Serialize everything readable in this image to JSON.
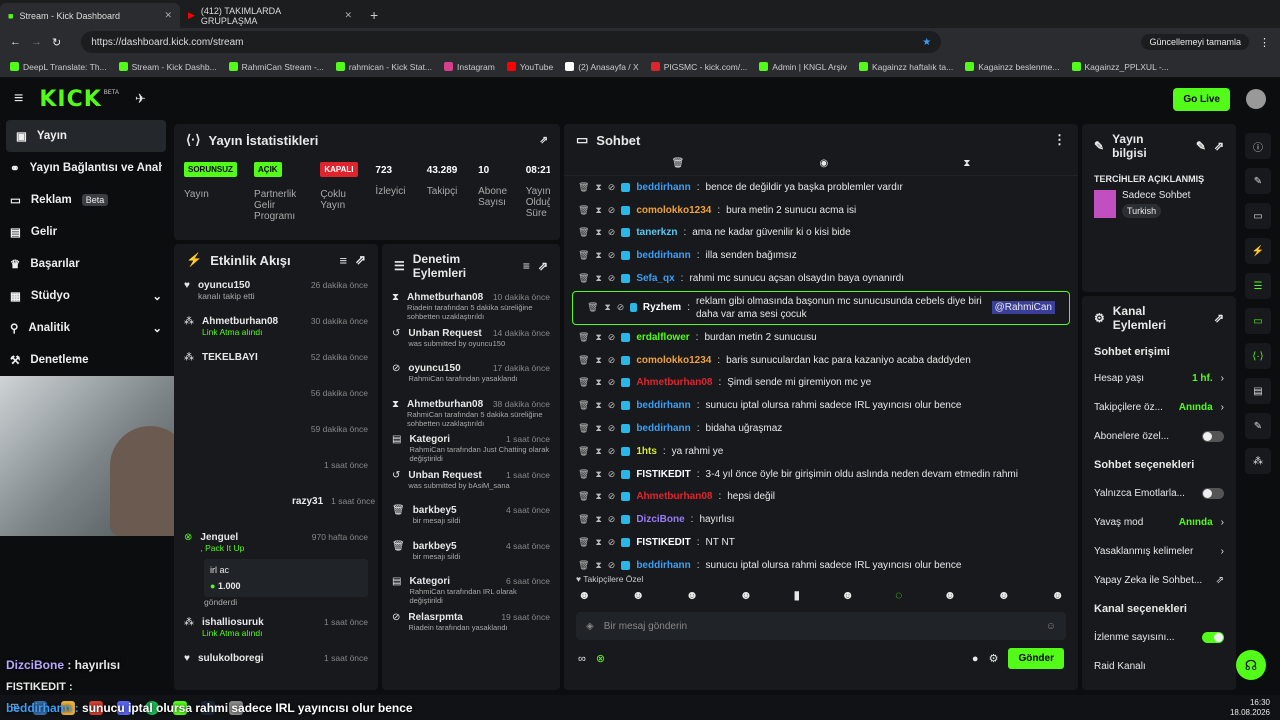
{
  "browser": {
    "tabs": [
      {
        "label": "Stream - Kick Dashboard",
        "active": true
      },
      {
        "label": "(412) TAKIMLARDA GRUPLAŞMA",
        "active": false
      }
    ],
    "url": "https://dashboard.kick.com/stream",
    "update_label": "Güncellemeyi tamamla",
    "bookmarks": [
      "DeepL Translate: Th...",
      "Stream - Kick Dashb...",
      "RahmiCan Stream -...",
      "rahmican - Kick Stat...",
      "Instagram",
      "YouTube",
      "(2) Anasayfa / X",
      "PIGSMC - kick.com/...",
      "Admin | KNGL Arşiv",
      "Kagainzz haftalık ta...",
      "Kagainzz beslenme...",
      "Kagainzz_PPLXUL -..."
    ]
  },
  "header": {
    "logo": "KICK",
    "beta": "BETA",
    "go_live": "Go Live"
  },
  "sidebar": {
    "items": [
      {
        "label": "Yayın",
        "active": true
      },
      {
        "label": "Yayın Bağlantısı ve Anahtarı"
      },
      {
        "label": "Reklam",
        "badge": "Beta"
      },
      {
        "label": "Gelir"
      },
      {
        "label": "Başarılar"
      },
      {
        "label": "Stüdyo"
      },
      {
        "label": "Analitik"
      },
      {
        "label": "Denetleme"
      }
    ]
  },
  "stats": {
    "title": "Yayın İstatistikleri",
    "cols": [
      {
        "badge": "SORUNSUZ",
        "badge_color": "#53fc18",
        "label": "Yayın"
      },
      {
        "badge": "AÇIK",
        "badge_color": "#53fc18",
        "label": "Partnerlik Gelir Programı"
      },
      {
        "badge": "KAPALI",
        "badge_color": "#e0242e",
        "label": "Çoklu Yayın"
      },
      {
        "value": "723",
        "label": "İzleyici"
      },
      {
        "value": "43.289",
        "label": "Takipçi"
      },
      {
        "value": "10",
        "label": "Abone Sayısı"
      },
      {
        "value": "08:21",
        "label": "Yayın Olduğu Süre"
      }
    ]
  },
  "activity": {
    "title": "Etkinlik Akışı",
    "items": [
      {
        "name": "oyuncu150",
        "sub": "kanalı takip etti",
        "time": "26 dakika önce"
      },
      {
        "name": "Ahmetburhan08",
        "sub": "Link Atma alındı",
        "time": "30 dakika önce"
      },
      {
        "name": "TEKELBAYI",
        "sub": "",
        "time": "52 dakika önce"
      },
      {
        "name": "",
        "sub": "",
        "time": "56 dakika önce"
      },
      {
        "name": "",
        "sub": "",
        "time": "59 dakika önce"
      },
      {
        "name": "",
        "sub": "",
        "time": "1 saat önce"
      },
      {
        "name": "razy31",
        "sub": "",
        "time": "1 saat önce"
      },
      {
        "name": "Jenguel",
        "sub": ", Pack It Up",
        "time": "970 hafta önce"
      }
    ],
    "gift": {
      "text": "irl ac",
      "amount": "1.000",
      "sent": "gönderdi"
    },
    "more": [
      {
        "name": "ishalliosuruk",
        "sub": "Link Atma alındı",
        "time": "1 saat önce"
      },
      {
        "name": "sulukolboregi",
        "sub": "",
        "time": "1 saat önce"
      }
    ]
  },
  "moderation": {
    "title": "Denetim Eylemleri",
    "items": [
      {
        "name": "Ahmetburhan08",
        "time": "10 dakika önce",
        "sub": "Riadein tarafından 5 dakika süreliğine sohbetten uzaklaştırıldı"
      },
      {
        "name": "Unban Request",
        "time": "14 dakika önce",
        "sub": "was submitted by oyuncu150"
      },
      {
        "name": "oyuncu150",
        "time": "17 dakika önce",
        "sub": "RahmiCan tarafından yasaklandı"
      },
      {
        "name": "Ahmetburhan08",
        "time": "38 dakika önce",
        "sub": "RahmiCan tarafından 5 dakika süreliğine sohbetten uzaklaştırıldı"
      },
      {
        "name": "Kategori",
        "time": "1 saat önce",
        "sub": "RahmiCan tarafından Just Chatting olarak değiştirildi"
      },
      {
        "name": "Unban Request",
        "time": "1 saat önce",
        "sub": "was submitted by bAsiM_sana"
      },
      {
        "name": "barkbey5",
        "time": "4 saat önce",
        "sub": "bir mesajı sildi"
      },
      {
        "name": "barkbey5",
        "time": "4 saat önce",
        "sub": "bir mesajı sildi"
      },
      {
        "name": "Kategori",
        "time": "6 saat önce",
        "sub": "RahmiCan tarafından IRL olarak değiştirildi"
      },
      {
        "name": "Relasrpmta",
        "time": "19 saat önce",
        "sub": "Riadein tarafından yasaklandı"
      }
    ]
  },
  "chat": {
    "title": "Sohbet",
    "messages": [
      {
        "user": "beddirhann",
        "color": "#3c9ff5",
        "text": "bence de değildir ya başka problemler vardır"
      },
      {
        "user": "comolokko1234",
        "color": "#f0a23b",
        "text": "bura metin 2 sunucu acma isi"
      },
      {
        "user": "tanerkzn",
        "color": "#5cc8f0",
        "text": "ama ne kadar güvenilir ki o kisi bide"
      },
      {
        "user": "beddirhann",
        "color": "#3c9ff5",
        "text": "illa senden bağımsız"
      },
      {
        "user": "Sefa_qx",
        "color": "#3c9ff5",
        "text": "rahmi mc sunucu açsan olsaydın baya oynanırdı"
      },
      {
        "user": "Ryzhem",
        "color": "#ffffff",
        "text": "reklam gibi olmasında başonun mc sunucusunda cebels diye biri daha var ama sesi çocuk",
        "mention": "@RahmiCan",
        "highlight": true
      },
      {
        "user": "erdalflower",
        "color": "#53fc18",
        "text": "burdan metin 2 sunucusu"
      },
      {
        "user": "comolokko1234",
        "color": "#f0a23b",
        "text": "baris sunuculardan kac para kazaniyo acaba daddyden"
      },
      {
        "user": "Ahmetburhan08",
        "color": "#e0242e",
        "text": "Şimdi sende mi giremiyon mc ye"
      },
      {
        "user": "beddirhann",
        "color": "#3c9ff5",
        "text": "sunucu iptal olursa rahmi sadece IRL yayıncısı olur bence"
      },
      {
        "user": "beddirhann",
        "color": "#3c9ff5",
        "text": "bidaha uğraşmaz"
      },
      {
        "user": "1hts",
        "color": "#d7e83a",
        "text": "ya rahmi ye"
      },
      {
        "user": "FISTIKEDIT",
        "color": "#ffffff",
        "text": "3-4 yıl önce öyle bir girişimin oldu aslında neden devam etmedin rahmi"
      },
      {
        "user": "Ahmetburhan08",
        "color": "#e0242e",
        "text": "hepsi değil"
      },
      {
        "user": "DizciBone",
        "color": "#9a7cf5",
        "text": "hayırlısı"
      },
      {
        "user": "FISTIKEDIT",
        "color": "#ffffff",
        "text": "NT NT"
      },
      {
        "user": "beddirhann",
        "color": "#3c9ff5",
        "text": "sunucu iptal olursa rahmi sadece IRL yayıncısı olur bence"
      }
    ],
    "followers_only": "Takipçilere Özel",
    "placeholder": "Bir mesaj gönderin",
    "send": "Gönder"
  },
  "info": {
    "title": "Yayın bilgisi",
    "section": "TERCİHLER AÇIKLANMIŞ",
    "category": "Sadece Sohbet",
    "language": "Turkish"
  },
  "channel": {
    "title": "Kanal Eylemleri",
    "chat_access": "Sohbet erişimi",
    "rows1": [
      {
        "label": "Hesap yaşı",
        "value": "1 hf."
      },
      {
        "label": "Takipçilere öz...",
        "value": "Anında"
      },
      {
        "label": "Abonelere özel...",
        "toggle": "off"
      }
    ],
    "chat_options": "Sohbet seçenekleri",
    "rows2": [
      {
        "label": "Yalnızca Emotlarla...",
        "toggle": "off"
      },
      {
        "label": "Yavaş mod",
        "value": "Anında"
      },
      {
        "label": "Yasaklanmış kelimeler"
      },
      {
        "label": "Yapay Zeka ile Sohbet..."
      }
    ],
    "channel_options": "Kanal seçenekleri",
    "rows3": [
      {
        "label": "İzlenme sayısını...",
        "toggle": "on"
      },
      {
        "label": "Raid Kanalı"
      }
    ]
  },
  "overlay": {
    "line1": "DizciBone : hayırlısı",
    "line2": "FISTIKEDIT :",
    "line3_user": "beddirhann :",
    "line3": "sunucu iptal olursa rahmi sadece IRL yayıncısı olur bence"
  },
  "clock": {
    "time": "16:30",
    "date": "18.08.2026"
  }
}
